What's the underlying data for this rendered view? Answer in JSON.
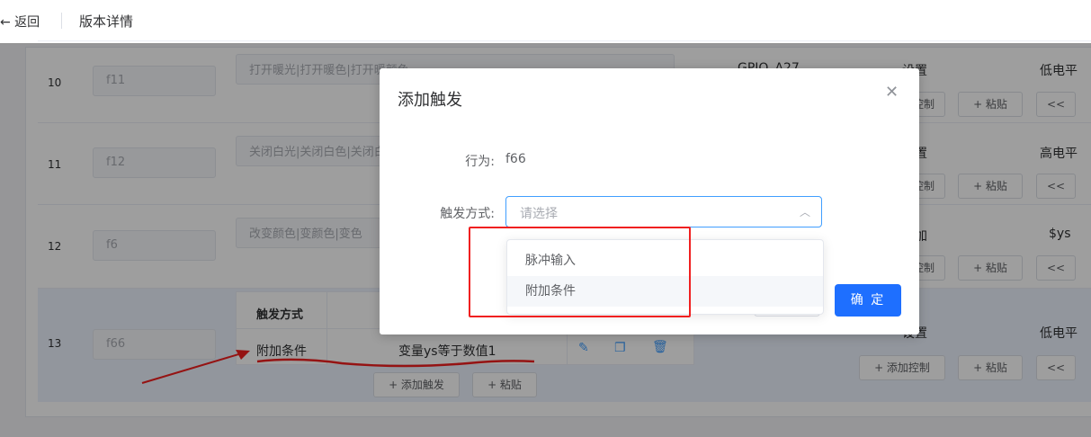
{
  "header": {
    "back_label": "← 返回",
    "title": "版本详情"
  },
  "rows": [
    {
      "index": "10",
      "name": "f11",
      "action": "打开暖光|打开暖色|打开暖颜色",
      "pin": "GPIO_A27",
      "op": "设置",
      "level": "低电平"
    },
    {
      "index": "11",
      "name": "f12",
      "action": "关闭白光|关闭白色|关闭白颜色",
      "op": "设置",
      "level": "高电平"
    },
    {
      "index": "12",
      "name": "f6",
      "action": "改变颜色|变颜色|变色",
      "op": "增加",
      "level": "$ys"
    },
    {
      "index": "13",
      "name": "f66",
      "op": "设置",
      "level": "低电平"
    }
  ],
  "trigger_table": {
    "header": "触发方式",
    "trigger": "附加条件",
    "condition": "变量ys等于数值1",
    "add_trigger_label": "+ 添加触发",
    "paste_label": "+ 粘贴"
  },
  "right_buttons": {
    "add_control_label": "+ 添加控制",
    "control_short": "控制",
    "paste_label": "+ 粘贴",
    "back_label": "<<"
  },
  "dialog": {
    "title": "添加触发",
    "behavior_label": "行为:",
    "behavior_value": "f66",
    "trigger_label": "触发方式:",
    "select_placeholder": "请选择",
    "options": [
      "脉冲输入",
      "附加条件"
    ],
    "ok_label": "确 定"
  },
  "colors": {
    "primary": "#1e6fff",
    "annotation": "#f02020",
    "highlight_row": "#ecf2fd"
  }
}
